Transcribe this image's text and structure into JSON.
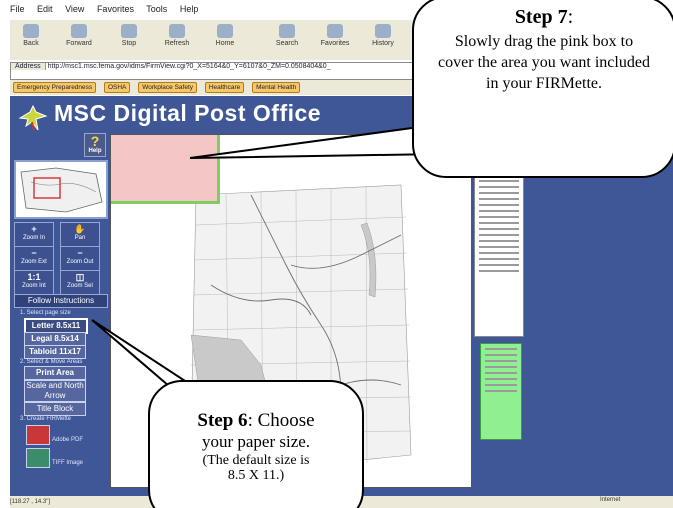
{
  "browser": {
    "menu": [
      "File",
      "Edit",
      "View",
      "Favorites",
      "Tools",
      "Help"
    ],
    "toolbar": [
      "Back",
      "Forward",
      "Stop",
      "Refresh",
      "Home",
      "Search",
      "Favorites",
      "History"
    ],
    "address_label": "Address",
    "address_url": "http://msc1.msc.fema.gov/idms/FirmView.cgi?0_X=5164&0_Y=6107&0_ZM=0.0508404&0_",
    "links": [
      "Emergency Preparedness",
      "OSHA",
      "Workplace Safety",
      "Healthcare",
      "Mental Health"
    ],
    "status_text": "[118.27 , 14.3\"]",
    "zone_text": "Internet"
  },
  "app": {
    "title": "MSC Digital Post Office",
    "help_label": "?",
    "help_sub": "Help",
    "tools": [
      {
        "label": "Zoom In",
        "glyph": "+"
      },
      {
        "label": "Pan",
        "glyph": "✋"
      },
      {
        "label": "Zoom Ext",
        "glyph": "−"
      },
      {
        "label": "Zoom Out",
        "glyph": "−"
      },
      {
        "label": "Zoom Int",
        "glyph": "1:1"
      },
      {
        "label": "Zoom Sel",
        "glyph": "◫"
      }
    ],
    "follow_label": "Follow Instructions",
    "step1_label": "1. Select page size",
    "paper_sizes": [
      "Letter 8.5x11",
      "Legal 8.5x14",
      "Tabloid 11x17"
    ],
    "step2_label": "2. Select & Move Areas",
    "area_buttons": [
      "Print Area",
      "Scale and North Arrow",
      "Title Block"
    ],
    "step3_label": "3. Create FIRMette",
    "outputs": [
      "Adobe PDF",
      "TIFF Image"
    ]
  },
  "callouts": {
    "step7_head": "Step 7",
    "step7_colon": ":",
    "step7_body": "Slowly drag the pink box to cover the area you want included in your FIRMette.",
    "step6_head": "Step 6",
    "step6_tail": ": Choose",
    "step6_body": "your paper size.",
    "step6_note": "(The default size is",
    "step6_note2": "8.5 X 11.)"
  },
  "colors": {
    "app_bg": "#3f5797",
    "pink_box": "#f4c6c6",
    "green_sheet": "#8ff08f"
  }
}
